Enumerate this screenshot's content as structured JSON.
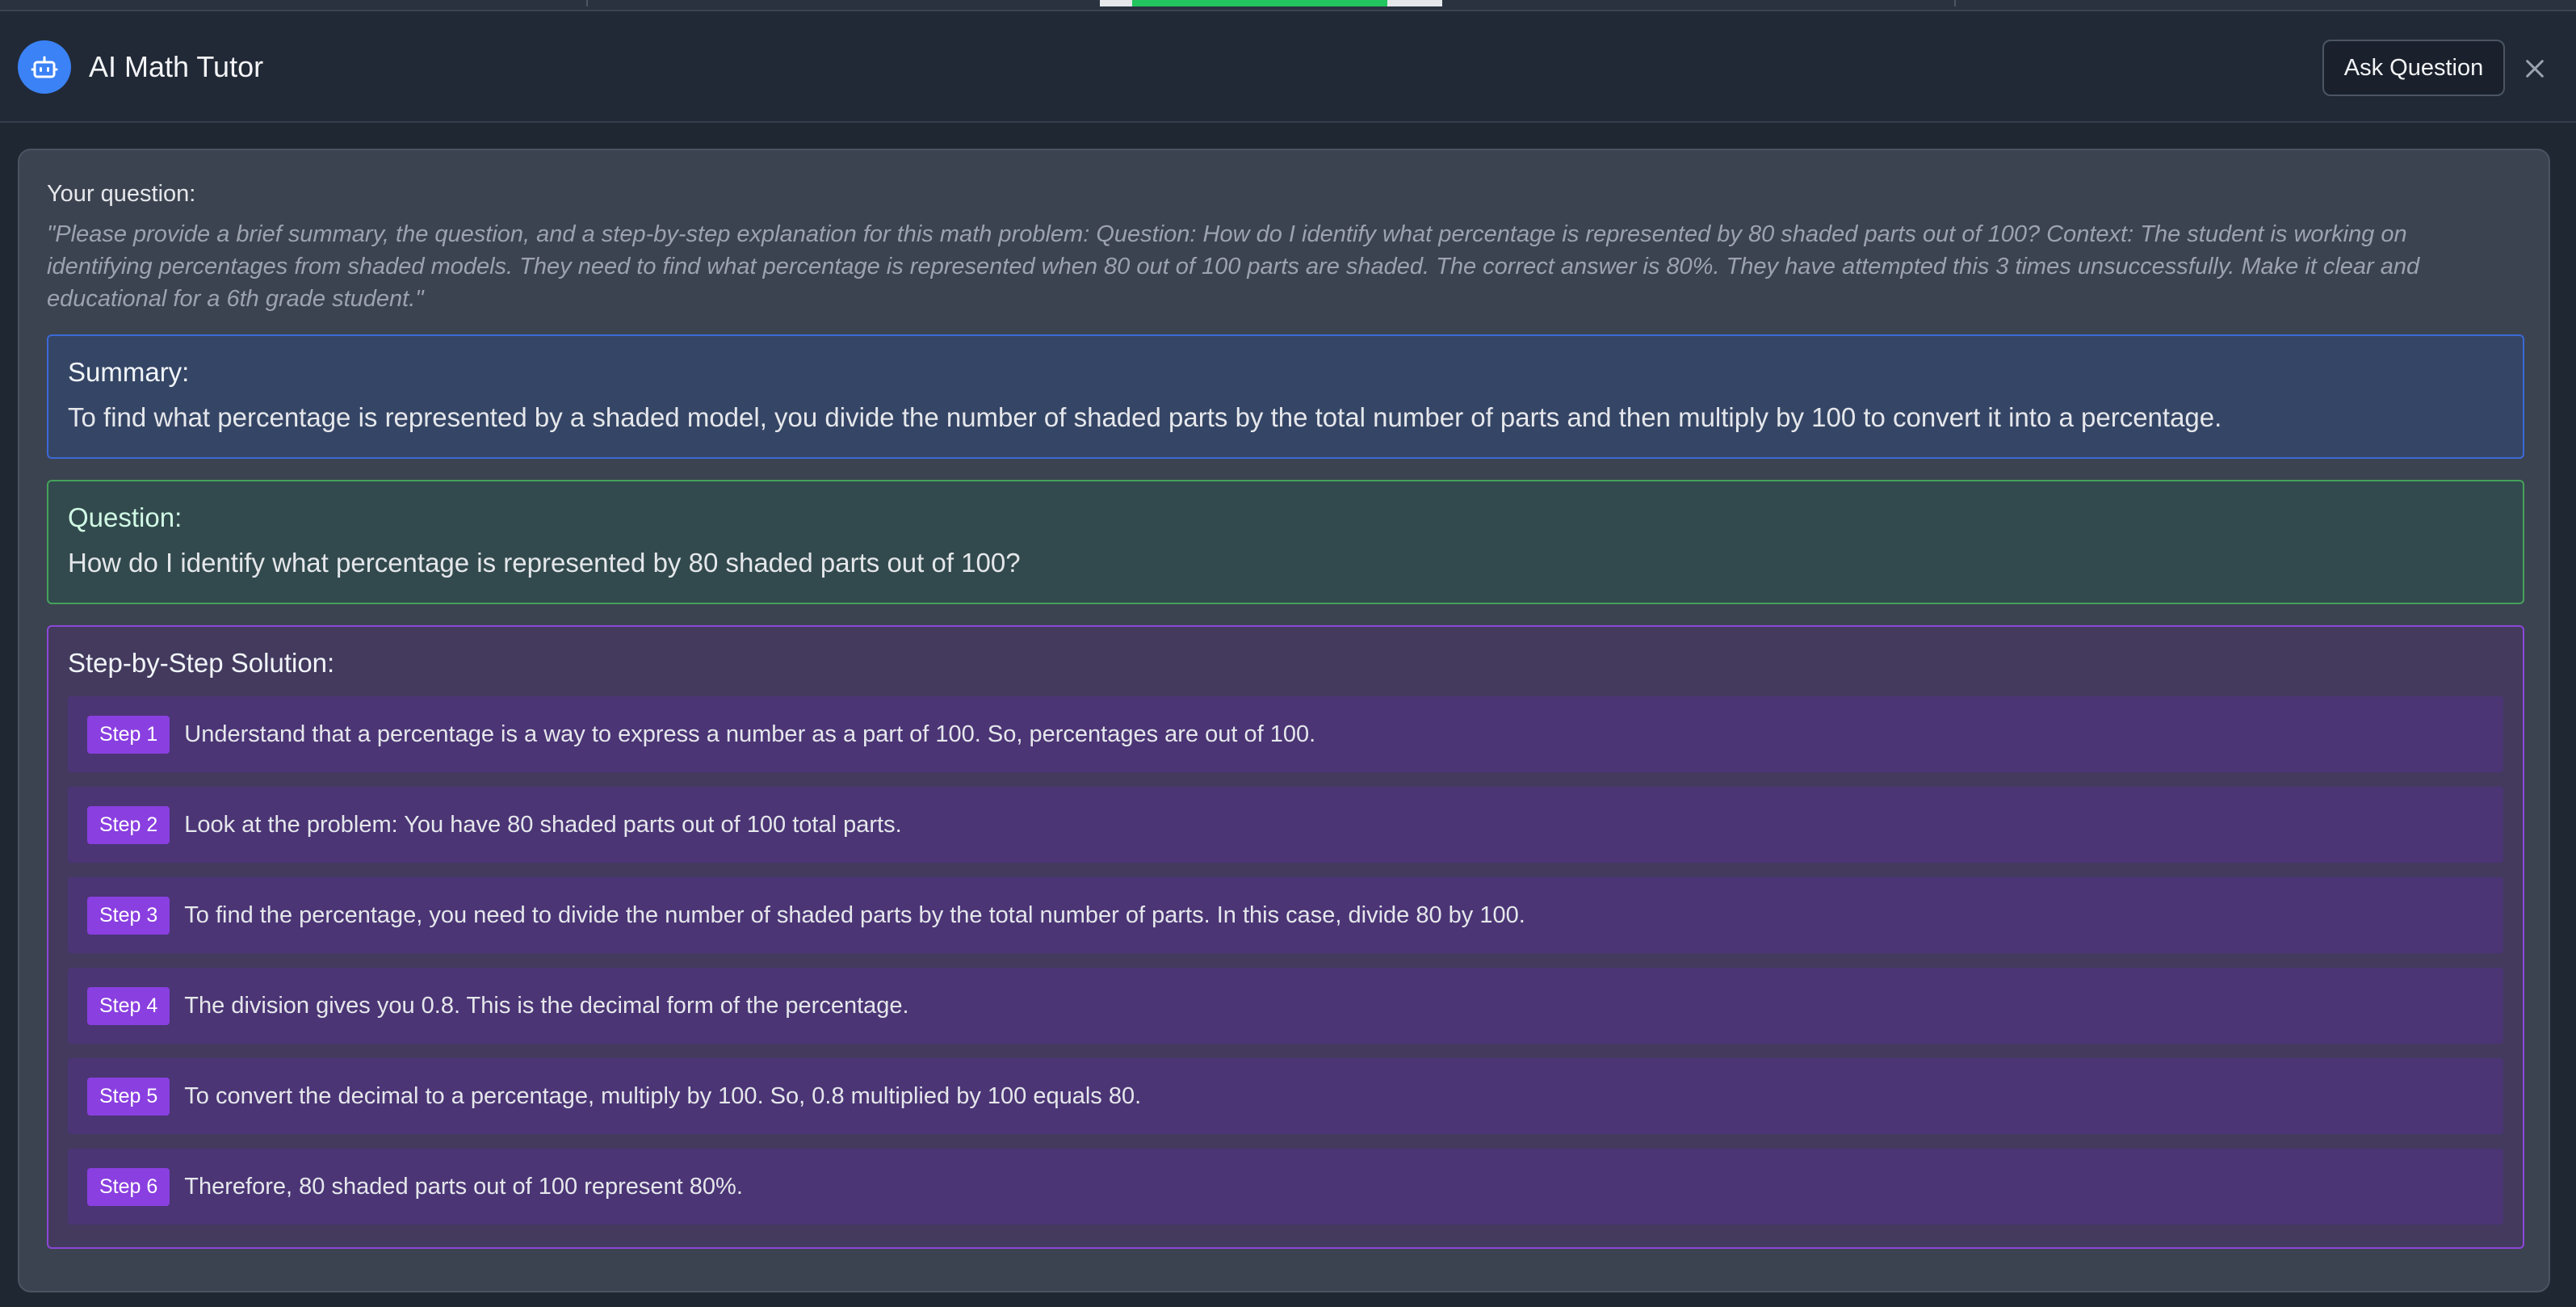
{
  "header": {
    "title": "AI Math Tutor",
    "ask_button_label": "Ask Question",
    "icons": [
      "robot-icon",
      "close-icon"
    ]
  },
  "user_question": {
    "label": "Your question:",
    "text": "\"Please provide a brief summary, the question, and a step-by-step explanation for this math problem: Question: How do I identify what percentage is represented by 80 shaded parts out of 100? Context: The student is working on identifying percentages from shaded models. They need to find what percentage is represented when 80 out of 100 parts are shaded. The correct answer is 80%. They have attempted this 3 times unsuccessfully. Make it clear and educational for a 6th grade student.\""
  },
  "summary": {
    "title": "Summary:",
    "text": "To find what percentage is represented by a shaded model, you divide the number of shaded parts by the total number of parts and then multiply by 100 to convert it into a percentage."
  },
  "question": {
    "title": "Question:",
    "text": "How do I identify what percentage is represented by 80 shaded parts out of 100?"
  },
  "solution": {
    "title": "Step-by-Step Solution:",
    "steps": [
      {
        "badge": "Step 1",
        "text": "Understand that a percentage is a way to express a number as a part of 100. So, percentages are out of 100."
      },
      {
        "badge": "Step 2",
        "text": "Look at the problem: You have 80 shaded parts out of 100 total parts."
      },
      {
        "badge": "Step 3",
        "text": "To find the percentage, you need to divide the number of shaded parts by the total number of parts. In this case, divide 80 by 100."
      },
      {
        "badge": "Step 4",
        "text": "The division gives you 0.8. This is the decimal form of the percentage."
      },
      {
        "badge": "Step 5",
        "text": "To convert the decimal to a percentage, multiply by 100. So, 0.8 multiplied by 100 equals 80."
      },
      {
        "badge": "Step 6",
        "text": "Therefore, 80 shaded parts out of 100 represent 80%."
      }
    ]
  },
  "colors": {
    "accent_blue": "#3b82f6",
    "summary_border": "#3b6ad6",
    "question_border": "#45a15a",
    "steps_border": "#8b48d8",
    "step_badge": "#8a3fe0"
  }
}
